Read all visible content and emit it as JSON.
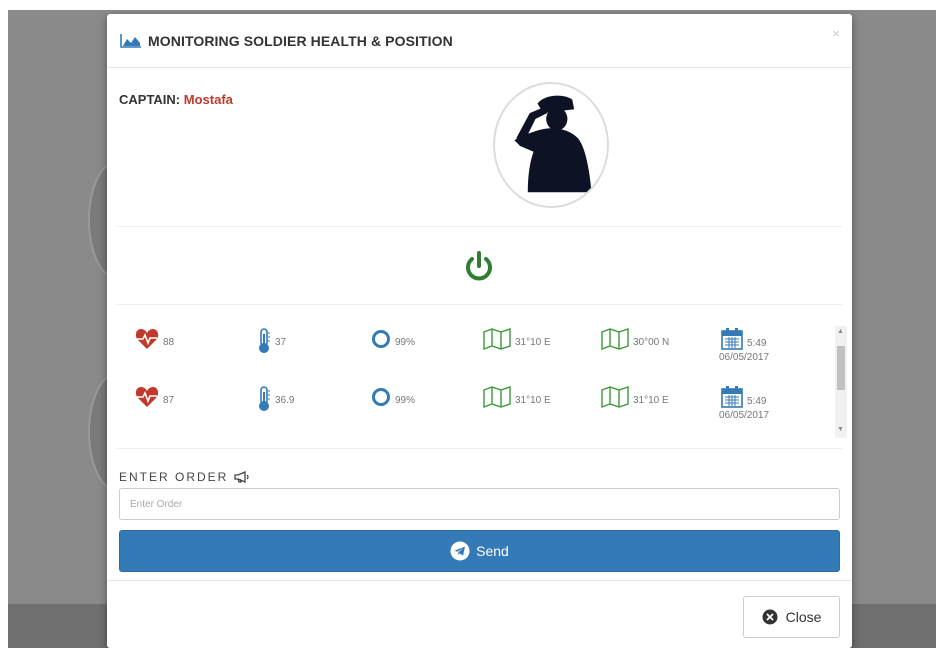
{
  "modal": {
    "title": "MONITORING SOLDIER HEALTH & POSITION",
    "close_glyph": "×"
  },
  "captain": {
    "label": "CAPTAIN:",
    "name": "Mostafa"
  },
  "colors": {
    "heart": "#c0392b",
    "thermometer": "#337ab7",
    "oxygen": "#337ab7",
    "map": "#3a9a3a",
    "calendar": "#337ab7",
    "power": "#2e7d32",
    "primary": "#337ab7",
    "captain_name": "#c0392b"
  },
  "readings": [
    {
      "heart_rate": "88",
      "temperature": "37",
      "oxygen": "99%",
      "longitude": "31°10 E",
      "latitude": "30°00 N",
      "time": "5:49",
      "date": "06/05/2017"
    },
    {
      "heart_rate": "87",
      "temperature": "36.9",
      "oxygen": "99%",
      "longitude": "31°10 E",
      "latitude": "31°10 E",
      "time": "5:49",
      "date": "06/05/2017"
    }
  ],
  "icons": {
    "heart": "heartbeat-icon",
    "thermometer": "thermometer-icon",
    "oxygen": "circle-o-icon",
    "map": "map-icon",
    "calendar": "calendar-icon",
    "power": "power-icon",
    "megaphone": "bullhorn-icon",
    "send": "telegram-icon",
    "close": "times-circle-icon"
  },
  "order": {
    "label": "ENTER ORDER",
    "placeholder": "Enter Order",
    "send_label": "Send"
  },
  "footer": {
    "close_label": "Close"
  }
}
